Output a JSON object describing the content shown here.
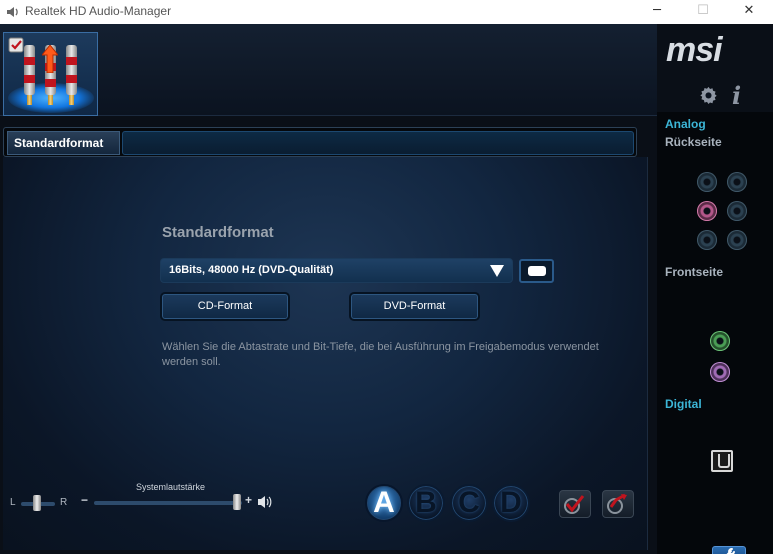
{
  "window": {
    "title": "Realtek HD Audio-Manager",
    "min_glyph": "─",
    "max_glyph": "☐",
    "close_glyph": "✕"
  },
  "brand": {
    "logo_text": "msi"
  },
  "toolbar": {
    "gear_icon": "gear-icon",
    "info_glyph": "i"
  },
  "tabs": [
    {
      "label": "Standardformat",
      "active": true
    }
  ],
  "content": {
    "section_title": "Standardformat",
    "format_select": {
      "value": "16Bits, 48000 Hz (DVD-Qualität)"
    },
    "buttons": {
      "cd_label": "CD-Format",
      "dvd_label": "DVD-Format"
    },
    "description": "Wählen Sie die Abtastrate und Bit-Tiefe, die bei Ausführung im Freigabemodus verwendet werden soll."
  },
  "volume": {
    "label": "Systemlautstärke",
    "balance_left": "L",
    "balance_right": "R",
    "minus": "−",
    "plus": "+"
  },
  "profiles": [
    {
      "label": "A",
      "active": true
    },
    {
      "label": "B",
      "active": false
    },
    {
      "label": "C",
      "active": false
    },
    {
      "label": "D",
      "active": false
    }
  ],
  "side_panel": {
    "analog_label": "Analog",
    "rear_label": "Rückseite",
    "front_label": "Frontseite",
    "digital_label": "Digital"
  },
  "colors": {
    "accent_cyan": "#3cb6d7",
    "select_blue": "#1f4166",
    "jack_pink": "#b4578a",
    "jack_green": "#4a9d55",
    "jack_violet": "#a06bb4"
  }
}
